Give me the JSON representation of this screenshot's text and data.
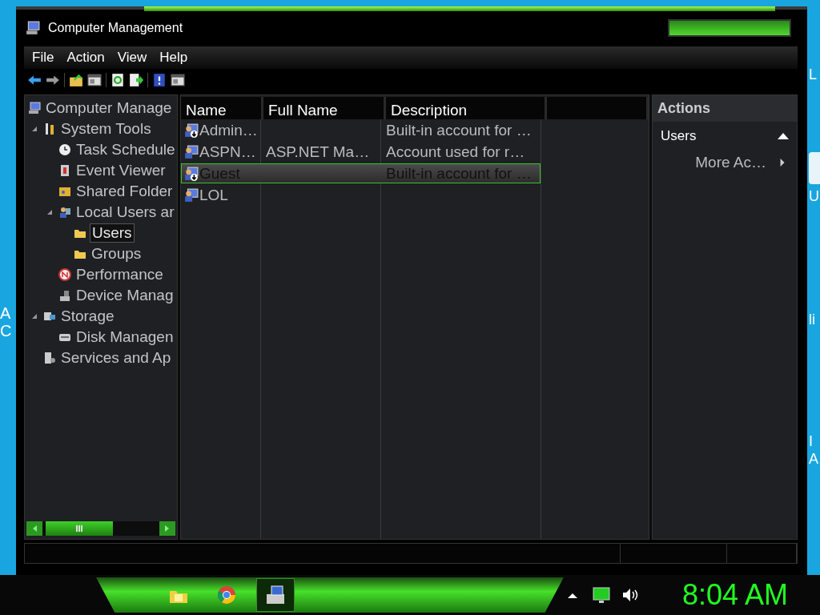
{
  "desktop": {
    "left_labels": [
      "A",
      "C"
    ],
    "right_labels": [
      "L",
      "U",
      "li",
      "I",
      "A"
    ]
  },
  "window": {
    "title": "Computer Management"
  },
  "menu": [
    "File",
    "Action",
    "View",
    "Help"
  ],
  "toolbar": [
    {
      "kind": "back"
    },
    {
      "kind": "forward"
    },
    {
      "kind": "sep"
    },
    {
      "kind": "up"
    },
    {
      "kind": "pane"
    },
    {
      "kind": "sep"
    },
    {
      "kind": "refresh"
    },
    {
      "kind": "export"
    },
    {
      "kind": "sep"
    },
    {
      "kind": "help"
    },
    {
      "kind": "pane"
    }
  ],
  "tree": [
    {
      "label": "Computer Manage",
      "selected": false,
      "expanded": false,
      "children": [
        {
          "label": "System Tools",
          "selected": false,
          "expanded": true,
          "children": [
            {
              "label": "Task Schedule",
              "selected": false,
              "expanded": false
            },
            {
              "label": "Event Viewer",
              "selected": false,
              "expanded": false
            },
            {
              "label": "Shared Folder",
              "selected": false,
              "expanded": false
            },
            {
              "label": "Local Users ar",
              "selected": false,
              "expanded": true,
              "children": [
                {
                  "label": "Users",
                  "selected": true,
                  "expanded": false
                },
                {
                  "label": "Groups",
                  "selected": false,
                  "expanded": false
                }
              ]
            },
            {
              "label": "Performance",
              "selected": false,
              "expanded": false
            },
            {
              "label": "Device Manag",
              "selected": false,
              "expanded": false
            }
          ]
        },
        {
          "label": "Storage",
          "selected": false,
          "expanded": true,
          "children": [
            {
              "label": "Disk Managen",
              "selected": false,
              "expanded": false
            }
          ]
        },
        {
          "label": "Services and Ap",
          "selected": false,
          "expanded": false
        }
      ]
    }
  ],
  "table": {
    "columns": [
      "Name",
      "Full Name",
      "Description"
    ],
    "rows": [
      {
        "name": "Admin…",
        "full_name": "",
        "description": "Built-in account for …",
        "disabled_user": true,
        "selected": false
      },
      {
        "name": "ASPN…",
        "full_name": "ASP.NET Ma…",
        "description": "Account used for r…",
        "disabled_user": false,
        "selected": false
      },
      {
        "name": "Guest",
        "full_name": "",
        "description": "Built-in account for …",
        "disabled_user": true,
        "selected": true
      },
      {
        "name": "LOL",
        "full_name": "",
        "description": "",
        "disabled_user": false,
        "selected": false
      }
    ]
  },
  "actions": {
    "title": "Actions",
    "sections": [
      {
        "label": "Users",
        "expanded": true,
        "items": [
          "More Ac…"
        ]
      }
    ]
  },
  "taskbar": {
    "apps": [
      {
        "kind": "folder",
        "active": false
      },
      {
        "kind": "browser",
        "active": false
      },
      {
        "kind": "console",
        "active": true
      }
    ],
    "clock": "8:04 AM"
  }
}
